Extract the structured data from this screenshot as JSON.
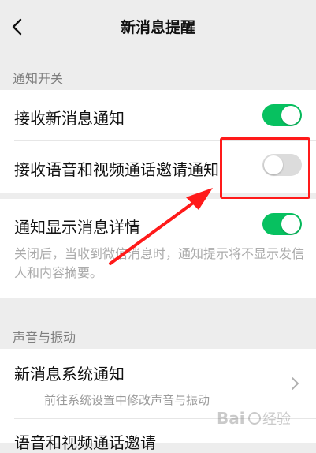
{
  "header": {
    "title": "新消息提醒",
    "back_icon": "chevron-left-icon"
  },
  "sections": {
    "notify_switch_label": "通知开关",
    "sound_vibration_label": "声音与振动"
  },
  "settings": {
    "receive_new_message": {
      "label": "接收新消息通知",
      "enabled": true
    },
    "receive_call_invite": {
      "label": "接收语音和视频通话邀请通知",
      "enabled": false
    },
    "show_message_detail": {
      "label": "通知显示消息详情",
      "enabled": true,
      "description": "关闭后，当收到微信消息时，通知提示将不显示发信人和内容摘要。"
    },
    "system_notification": {
      "label": "新消息系统通知",
      "subtitle": "前往系统设置中修改声音与振动",
      "icon": "chevron-right-icon"
    },
    "call_invite_sound": {
      "label": "语音和视频通话邀请"
    }
  },
  "colors": {
    "toggle_on": "#07c160",
    "toggle_off": "#dcdcdc",
    "annotation": "#ff1a1a"
  }
}
